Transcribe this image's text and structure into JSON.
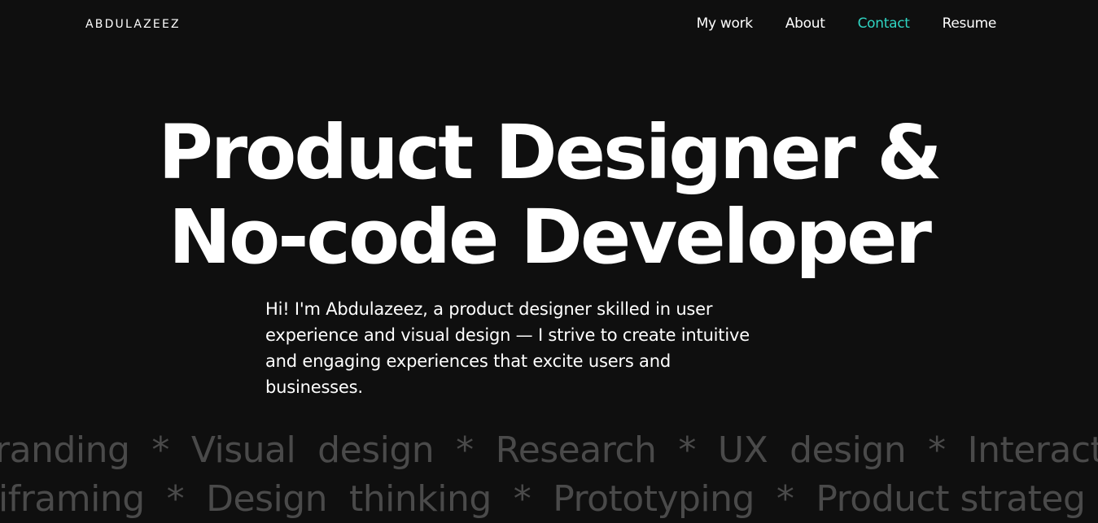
{
  "header": {
    "logo": "ABDULAZEEZ",
    "nav": [
      {
        "label": "My work"
      },
      {
        "label": "About"
      },
      {
        "label": "Contact"
      },
      {
        "label": "Resume"
      }
    ],
    "active_nav": "Contact"
  },
  "hero": {
    "title_line1": "Product Designer &",
    "title_line2": "No-code Developer",
    "intro": "Hi! I'm Abdulazeez, a product designer skilled in user experience and visual design — I strive to create intuitive and engaging experiences that excite users and businesses."
  },
  "skills_marquee": {
    "row1": "randing  *  Visual  design  *  Research  *  UX  design  *  Interactio",
    "row2": "iframing  *  Design  thinking  *  Prototyping  *  Product strateg"
  },
  "colors": {
    "background": "#0f0f0f",
    "text": "#ffffff",
    "accent": "#2fd4c2",
    "marquee_text": "#4a4a4a"
  }
}
